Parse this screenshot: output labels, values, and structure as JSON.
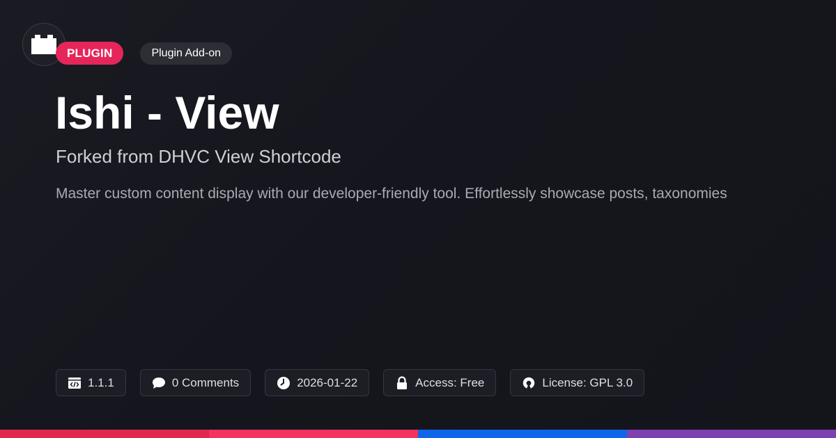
{
  "badges": {
    "type": "PLUGIN",
    "category": "Plugin Add-on"
  },
  "title": "Ishi - View",
  "subtitle": "Forked from DHVC View Shortcode",
  "description": "Master custom content display with our developer-friendly tool. Effortlessly showcase posts, taxonomies",
  "meta": {
    "version": "1.1.1",
    "comments": "0 Comments",
    "date": "2026-01-22",
    "access": "Access: Free",
    "license": "License: GPL 3.0"
  },
  "icons": {
    "logo": "plugin-block-icon",
    "version": "code-icon",
    "comments": "speech-bubble-icon",
    "date": "clock-icon",
    "access": "lock-icon",
    "license": "open-source-icon"
  },
  "colors": {
    "background": "#16171e",
    "accent": "#e6265a",
    "bar": [
      "#e0274f",
      "#f2325f",
      "#0f66e8",
      "#7e3fb0"
    ]
  }
}
